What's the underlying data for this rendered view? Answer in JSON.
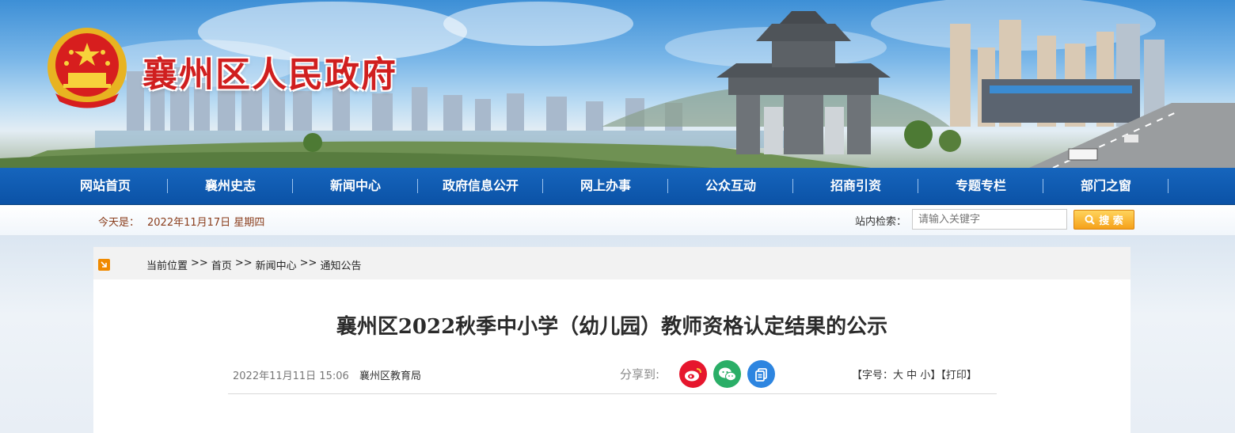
{
  "header": {
    "site_title": "襄州区人民政府"
  },
  "nav": {
    "items": [
      {
        "label": "网站首页"
      },
      {
        "label": "襄州史志"
      },
      {
        "label": "新闻中心"
      },
      {
        "label": "政府信息公开"
      },
      {
        "label": "网上办事"
      },
      {
        "label": "公众互动"
      },
      {
        "label": "招商引资"
      },
      {
        "label": "专题专栏"
      },
      {
        "label": "部门之窗"
      }
    ]
  },
  "infobar": {
    "today_label": "今天是：",
    "today_date": "2022年11月17日 星期四",
    "search_label": "站内检索：",
    "search_placeholder": "请输入关键字",
    "search_button": "搜 索"
  },
  "breadcrumb": {
    "label": "当前位置",
    "sep": ">>",
    "items": [
      {
        "label": "首页"
      },
      {
        "label": "新闻中心"
      },
      {
        "label": "通知公告"
      }
    ]
  },
  "article": {
    "title": "襄州区2022秋季中小学（幼儿园）教师资格认定结果的公示",
    "date": "2022年11月11日 15:06",
    "source": "襄州区教育局",
    "share_label": "分享到:",
    "share_icons": [
      "weibo-icon",
      "wechat-icon",
      "qzone-icon"
    ],
    "fontsize_prefix": "【字号：",
    "fontsize_large": "大",
    "fontsize_medium": "中",
    "fontsize_small": "小",
    "fontsize_suffix": "】",
    "print_label": "【打印】"
  },
  "colors": {
    "nav_bg": "#0b52a6",
    "title_red": "#d01f1f",
    "search_button": "#f5a11a",
    "weibo": "#e6162d",
    "wechat": "#2aae67",
    "qzone": "#2d85e0"
  }
}
